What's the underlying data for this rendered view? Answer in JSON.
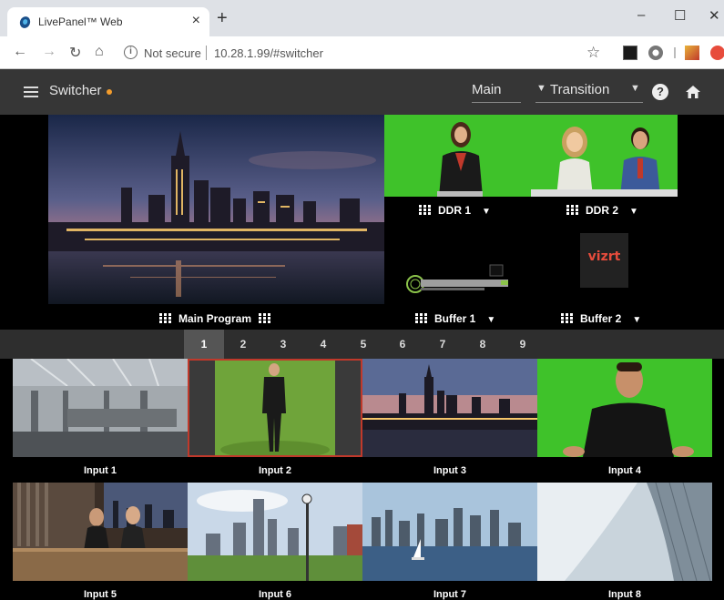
{
  "browser": {
    "tab_title": "LivePanel™ Web",
    "tab_close": "×",
    "new_tab": "+",
    "window_minimize": "–",
    "window_maximize": "☐",
    "window_close": "✕",
    "security_label": "Not secure",
    "url": "10.28.1.99/#switcher",
    "icons": [
      "back-icon",
      "forward-icon",
      "reload-icon",
      "home-icon",
      "info-icon",
      "star-icon"
    ]
  },
  "app": {
    "title": "Switcher",
    "status_color": "#f39c2c",
    "main_select": "Main",
    "transition_select": "Transition",
    "help": "?"
  },
  "preview": {
    "main_program_label": "Main Program",
    "ddr1_label": "DDR 1",
    "ddr2_label": "DDR 2",
    "buffer1_label": "Buffer 1",
    "buffer2_label": "Buffer 2",
    "buffer2_logo": "vizrt"
  },
  "pages": [
    "1",
    "2",
    "3",
    "4",
    "5",
    "6",
    "7",
    "8",
    "9"
  ],
  "active_page": "1",
  "inputs": [
    {
      "label": "Input 1"
    },
    {
      "label": "Input 2",
      "selected": true
    },
    {
      "label": "Input 3"
    },
    {
      "label": "Input 4"
    },
    {
      "label": "Input 5"
    },
    {
      "label": "Input 6"
    },
    {
      "label": "Input 7"
    },
    {
      "label": "Input 8"
    }
  ],
  "colors": {
    "header_bg": "#363636",
    "pagebar_bg": "#2e2e2e",
    "active_page_bg": "#555555",
    "selected_outline": "#c0392b",
    "greenscreen": "#3fc22a"
  }
}
